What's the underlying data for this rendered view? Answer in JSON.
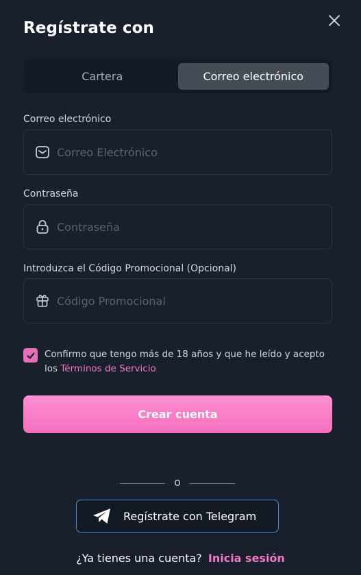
{
  "header": {
    "title": "Regístrate con"
  },
  "tabs": [
    {
      "label": "Cartera",
      "active": false
    },
    {
      "label": "Correo electrónico",
      "active": true
    }
  ],
  "form": {
    "email": {
      "label": "Correo electrónico",
      "placeholder": "Correo Electrónico",
      "icon": "envelope-icon",
      "value": ""
    },
    "password": {
      "label": "Contraseña",
      "placeholder": "Contraseña",
      "icon": "lock-icon",
      "value": ""
    },
    "promo": {
      "label": "Introduzca el Código Promocional (Opcional)",
      "placeholder": "Código Promocional",
      "icon": "gift-icon",
      "value": ""
    }
  },
  "terms": {
    "checked": true,
    "text": "Confirmo que tengo más de 18 años y que he leído y acepto los",
    "link": "Términos de Servicio"
  },
  "actions": {
    "create_label": "Crear cuenta",
    "divider_text": "o",
    "telegram_label": "Regístrate con Telegram"
  },
  "footer": {
    "question": "¿Ya tienes una cuenta?",
    "login_link": "Inicia sesión"
  },
  "colors": {
    "background": "#1a202b",
    "accent_pink": "#f46fbd",
    "telegram_border": "#3e8fd8",
    "active_tab": "#454c56"
  }
}
